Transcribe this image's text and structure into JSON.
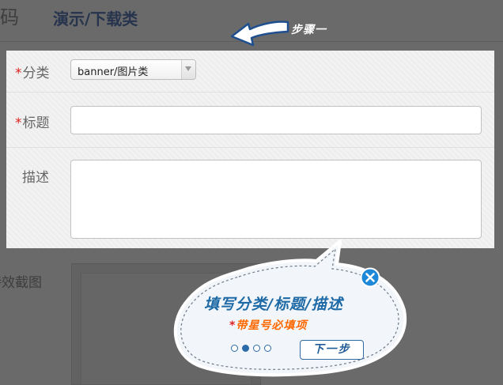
{
  "background": {
    "title_partial": "码",
    "breadcrumb_link": "演示/下载类",
    "screenshot_label": "特效截图"
  },
  "guide": {
    "step_label": "步骤一"
  },
  "form": {
    "category": {
      "required_mark": "*",
      "label": "分类",
      "selected": "banner/图片类"
    },
    "title": {
      "required_mark": "*",
      "label": "标题",
      "value": ""
    },
    "description": {
      "label": "描述",
      "value": ""
    }
  },
  "tooltip": {
    "heading": "填写分类/标题/描述",
    "note_mark": "*",
    "note": "带星号必填项",
    "pagination": {
      "total": 4,
      "active_index": 1
    },
    "next_label": "下一步",
    "colors": {
      "heading": "#1e6aa6",
      "note": "#ff6a00",
      "required": "#e02020",
      "close_button": "#1e88d8"
    }
  }
}
